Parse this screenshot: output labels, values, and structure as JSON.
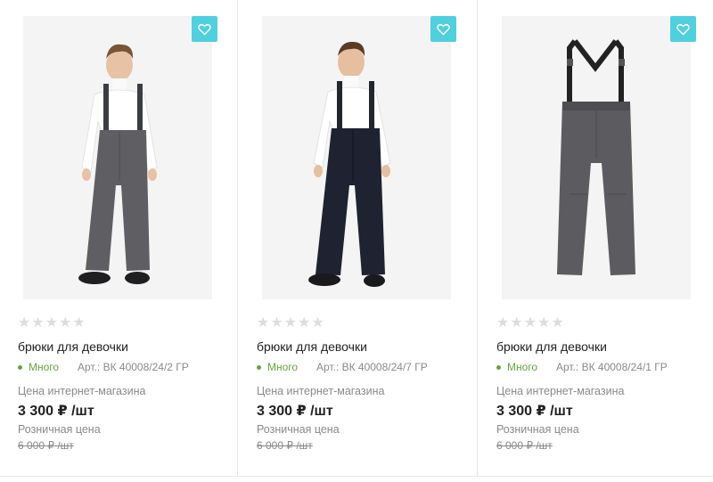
{
  "products": [
    {
      "image_desc": "boy-gray-trousers",
      "rating_stars": 0,
      "title": "брюки для девочки",
      "stock": "Много",
      "article": "Арт.: ВК 40008/24/2 ГР",
      "price_label": "Цена интернет-магазина",
      "price": "3 300 ₽ /шт",
      "retail_label": "Розничная цена",
      "retail_price": "6 000 ₽ /шт"
    },
    {
      "image_desc": "boy-black-trousers",
      "rating_stars": 0,
      "title": "брюки для девочки",
      "stock": "Много",
      "article": "Арт.: ВК 40008/24/7 ГР",
      "price_label": "Цена интернет-магазина",
      "price": "3 300 ₽ /шт",
      "retail_label": "Розничная цена",
      "retail_price": "6 000 ₽ /шт"
    },
    {
      "image_desc": "gray-trousers-flatlay",
      "rating_stars": 0,
      "title": "брюки для девочки",
      "stock": "Много",
      "article": "Арт.: ВК 40008/24/1 ГР",
      "price_label": "Цена интернет-магазина",
      "price": "3 300 ₽ /шт",
      "retail_label": "Розничная цена",
      "retail_price": "6 000 ₽ /шт"
    }
  ],
  "colors": {
    "favorite_button": "#4fd0de",
    "in_stock": "#62a838",
    "star_empty": "#dddddd",
    "muted_text": "#8a8a8a"
  },
  "icons": {
    "favorite": "heart-icon",
    "star": "star-icon"
  }
}
